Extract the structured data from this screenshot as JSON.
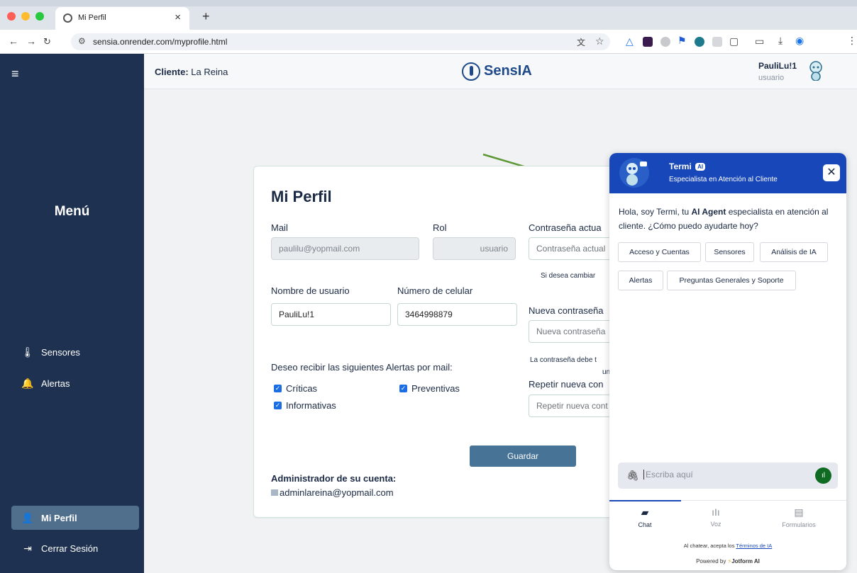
{
  "browser": {
    "tab_title": "Mi Perfil",
    "url": "sensia.onrender.com/myprofile.html"
  },
  "sidebar": {
    "menu_title": "Menú",
    "items": [
      {
        "label": "Sensores",
        "icon": "thermometer-icon"
      },
      {
        "label": "Alertas",
        "icon": "bell-icon"
      },
      {
        "label": "Mi Perfil",
        "icon": "user-icon"
      },
      {
        "label": "Cerrar Sesión",
        "icon": "logout-icon"
      }
    ]
  },
  "header": {
    "client_label": "Cliente:",
    "client_name": "La Reina",
    "logo_text": "SensIA",
    "user_name": "PauliLu!1",
    "user_role": "usuario"
  },
  "profile": {
    "title": "Mi Perfil",
    "mail_label": "Mail",
    "mail_value": "paulilu@yopmail.com",
    "role_label": "Rol",
    "role_value": "usuario",
    "username_label": "Nombre de usuario",
    "username_value": "PauliLu!1",
    "phone_label": "Número de celular",
    "phone_value": "3464998879",
    "current_pwd_label": "Contraseña actua",
    "current_pwd_placeholder": "Contraseña actual",
    "change_note": "Si desea cambiar",
    "new_pwd_label": "Nueva contraseña",
    "new_pwd_placeholder": "Nueva contraseña",
    "pwd_rule_1": "La contraseña debe t",
    "pwd_rule_2": "unc",
    "repeat_pwd_label": "Repetir nueva con",
    "repeat_pwd_placeholder": "Repetir nueva cont",
    "alerts_label": "Deseo recibir las siguientes Alertas por mail:",
    "alert_critical": "Críticas",
    "alert_preventive": "Preventivas",
    "alert_info": "Informativas",
    "save_label": "Guardar",
    "admin_label": "Administrador de su cuenta:",
    "admin_email": "adminlareina@yopmail.com"
  },
  "chat": {
    "agent_name": "Termi",
    "agent_badge": "AI",
    "agent_subtitle": "Especialista en Atención al Cliente",
    "close_label": "✕",
    "message_pre": "Hola, soy Termi, tu ",
    "message_bold": "AI Agent",
    "message_post": " especialista en atención al cliente. ¿Cómo puedo ayudarte hoy?",
    "chips": [
      "Acceso y Cuentas",
      "Sensores",
      "Análisis de IA",
      "Alertas",
      "Preguntas Generales y Soporte"
    ],
    "input_placeholder": "Escriba aquí",
    "tabs": [
      "Chat",
      "Voz",
      "Formularios"
    ],
    "terms_pre": "Al chatear, acepta los ",
    "terms_link": "Términos de IA",
    "powered_pre": "Powered by ",
    "powered_brand": "Jotform AI"
  },
  "colors": {
    "sidebar_bg": "#1f3150",
    "active_item": "#4f6f8d",
    "button_bg": "#477396",
    "chat_header": "#1747b8",
    "arrow": "#5d9733"
  }
}
